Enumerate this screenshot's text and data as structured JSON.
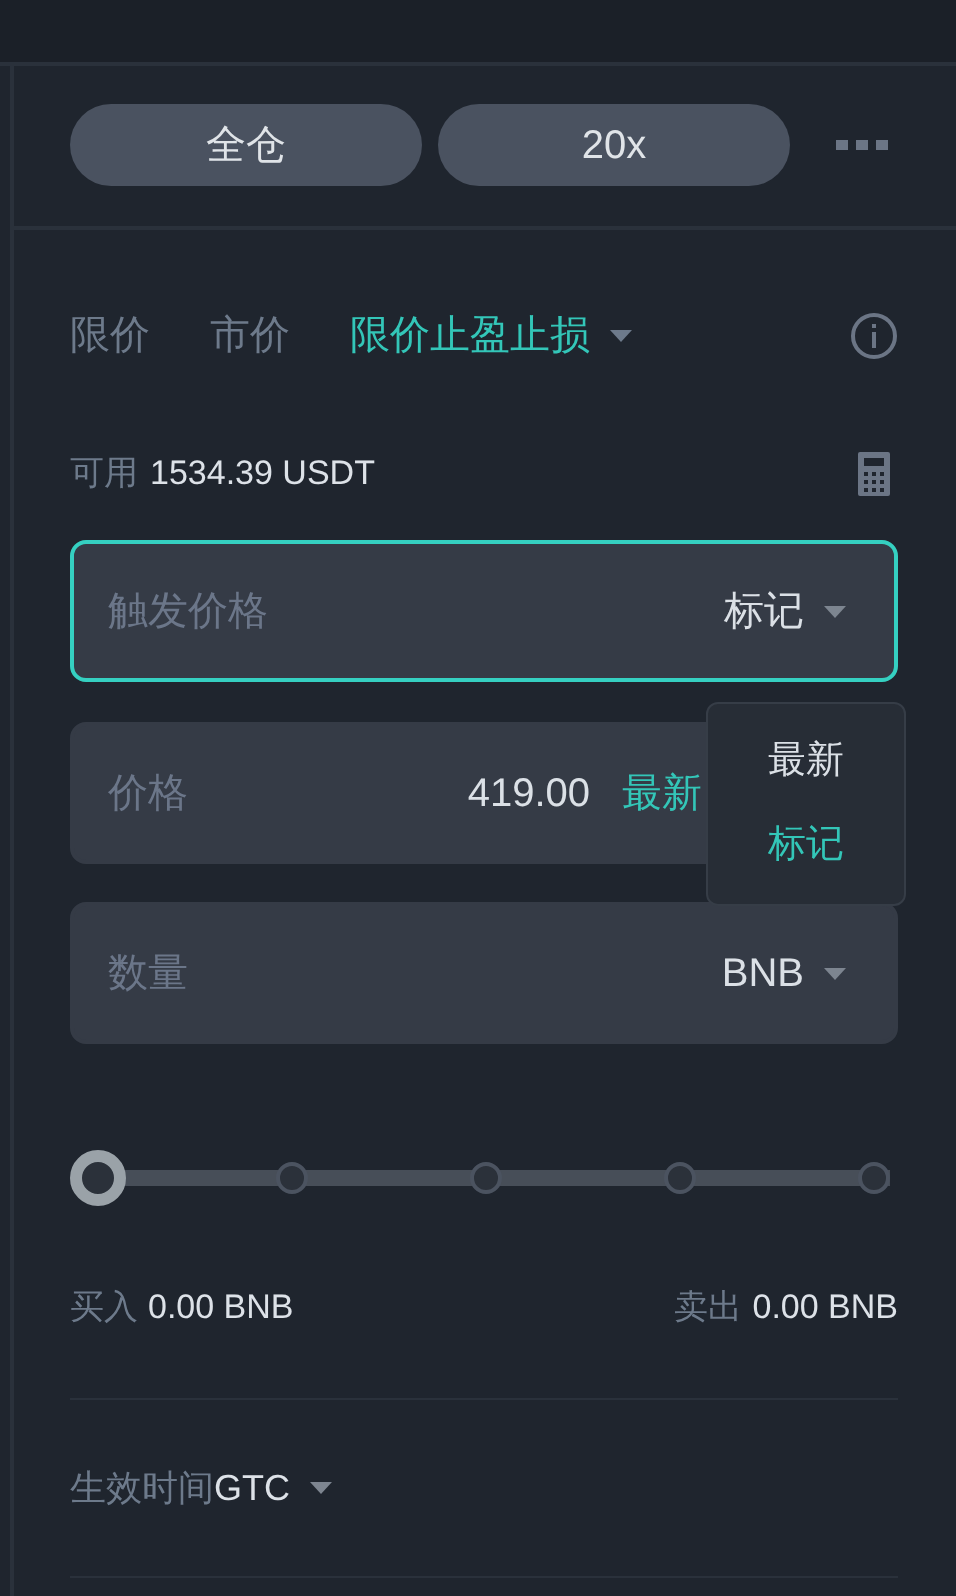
{
  "margin_mode": {
    "label": "全仓"
  },
  "leverage": {
    "label": "20x"
  },
  "order_types": [
    {
      "label": "限价",
      "selected": false,
      "has_menu": false
    },
    {
      "label": "市价",
      "selected": false,
      "has_menu": false
    },
    {
      "label": "限价止盈止损",
      "selected": true,
      "has_menu": true
    }
  ],
  "available": {
    "label": "可用",
    "value": "1534.39 USDT"
  },
  "fields": [
    {
      "label": "触发价格",
      "unit": "标记",
      "focused": true,
      "has_menu": true
    },
    {
      "label": "价格",
      "value": "419.00",
      "unit": "最新",
      "focused": false,
      "has_menu": false
    },
    {
      "label": "数量",
      "unit": "BNB",
      "focused": false,
      "has_menu": true
    }
  ],
  "price_type_menu": [
    {
      "label": "最新",
      "selected": false
    },
    {
      "label": "标记",
      "selected": true
    }
  ],
  "amount_slider": {
    "level": 0
  },
  "buy": {
    "label": "买入",
    "value": "0.00 BNB"
  },
  "sell": {
    "label": "卖出",
    "value": "0.00 BNB"
  },
  "time_in_force": {
    "label": "生效时间",
    "value": "GTC"
  }
}
